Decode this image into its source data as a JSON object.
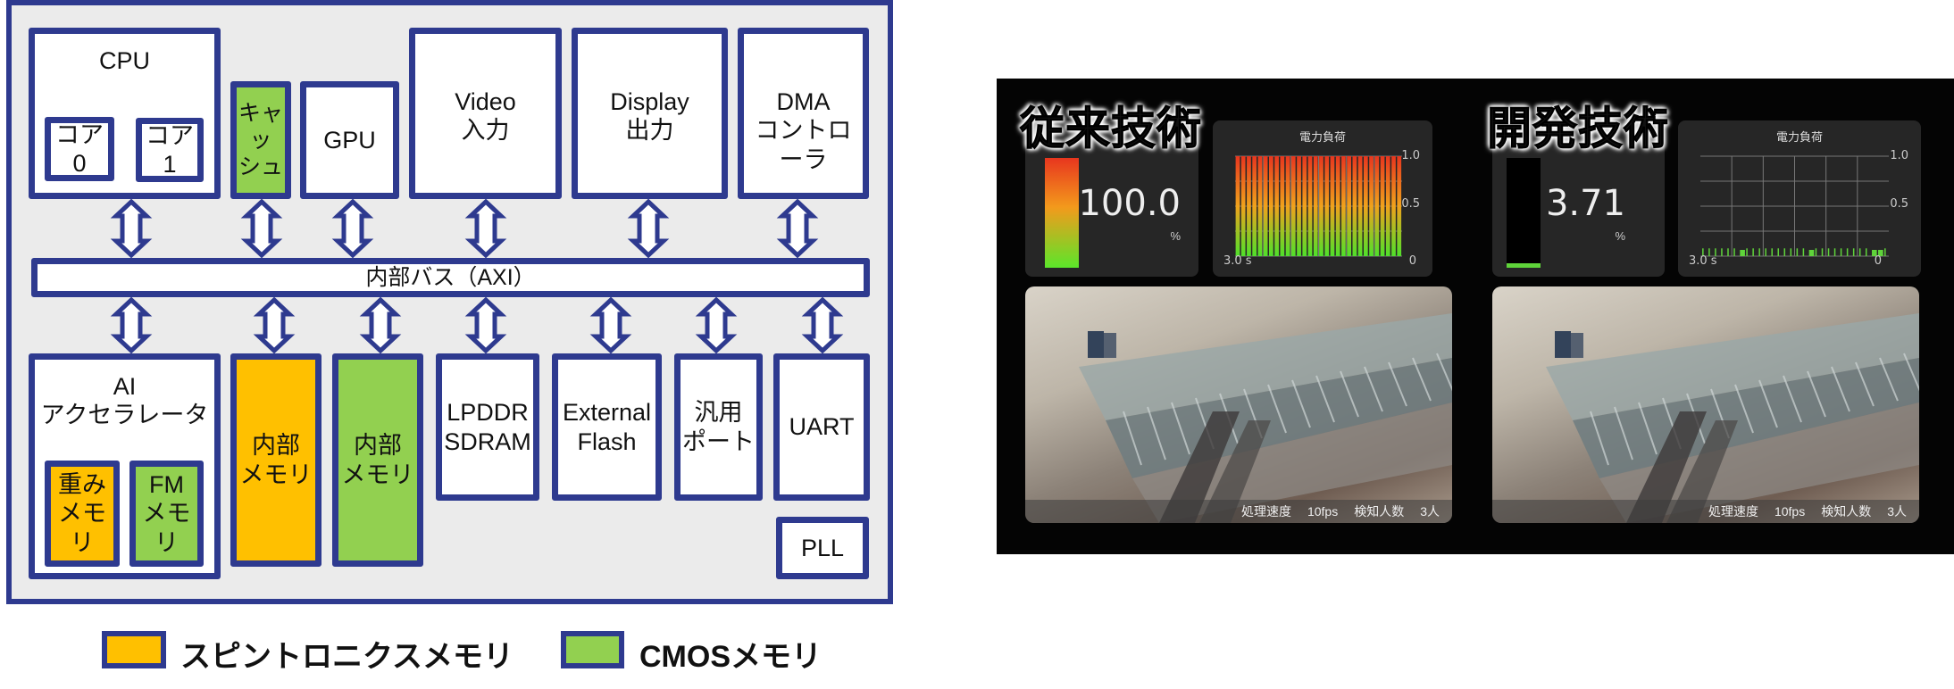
{
  "diagram": {
    "bus_label": "内部バス（AXI）",
    "blocks": {
      "cpu": "CPU",
      "core0": "コア0",
      "core1": "コア1",
      "cache_line1": "キャッ",
      "cache_line2": "シュ",
      "gpu": "GPU",
      "video_line1": "Video",
      "video_line2": "入力",
      "display_line1": "Display",
      "display_line2": "出力",
      "dma_line1": "DMA",
      "dma_line2": "コントローラ",
      "ai_line1": "AI",
      "ai_line2": "アクセラレータ",
      "weight_mem_line1": "重み",
      "weight_mem_line2": "メモリ",
      "fm_mem_line1": "FM",
      "fm_mem_line2": "メモリ",
      "internal_mem_spin_line1": "内部",
      "internal_mem_spin_line2": "メモリ",
      "internal_mem_cmos_line1": "内部",
      "internal_mem_cmos_line2": "メモリ",
      "lpddr_line1": "LPDDR",
      "lpddr_line2": "SDRAM",
      "flash_line1": "External",
      "flash_line2": "Flash",
      "gpio_line1": "汎用",
      "gpio_line2": "ポート",
      "uart": "UART",
      "pll": "PLL"
    },
    "colors": {
      "border": "#2e3a8f",
      "spintronics": "#ffc000",
      "cmos": "#92d050",
      "background": "#ebebeb"
    },
    "legend": [
      {
        "label": "スピントロニクスメモリ",
        "color": "#ffc000"
      },
      {
        "label": "CMOSメモリ",
        "color": "#92d050"
      }
    ]
  },
  "demo": {
    "panels": [
      {
        "heading": "従来技術",
        "gauge_value": "100.0",
        "gauge_unit": "%",
        "gauge_level": 1.0,
        "chart_title": "電力負荷",
        "status_speed_label": "処理速度",
        "status_speed_value": "10fps",
        "status_count_label": "検知人数",
        "status_count_value": "3人"
      },
      {
        "heading": "開発技術",
        "gauge_value": "3.71",
        "gauge_unit": "%",
        "gauge_level": 0.0371,
        "chart_title": "電力負荷",
        "status_speed_label": "処理速度",
        "status_speed_value": "10fps",
        "status_count_label": "検知人数",
        "status_count_value": "3人"
      }
    ]
  },
  "chart_data": [
    {
      "type": "bar",
      "title": "電力負荷",
      "x_ticks": [
        "3.0 s",
        "0"
      ],
      "y_ticks": [
        "1.0",
        "0.5"
      ],
      "ylim": [
        0,
        1.0
      ],
      "xlim_s": [
        3.0,
        0
      ],
      "grid": true,
      "values": [
        1,
        1,
        1,
        1,
        1,
        1,
        1,
        1,
        1,
        1,
        1,
        1,
        1,
        1,
        1,
        1,
        1,
        1,
        1,
        1,
        1,
        1,
        1,
        1,
        1,
        1,
        1,
        1,
        1,
        1
      ]
    },
    {
      "type": "bar",
      "title": "電力負荷",
      "x_ticks": [
        "3.0 s",
        "0"
      ],
      "y_ticks": [
        "1.0",
        "0.5"
      ],
      "ylim": [
        0,
        1.0
      ],
      "xlim_s": [
        3.0,
        0
      ],
      "grid": true,
      "values": [
        0.02,
        0.02,
        0.02,
        0.02,
        0.02,
        0.02,
        0.05,
        0.02,
        0.02,
        0.02,
        0.02,
        0.02,
        0.02,
        0.02,
        0.02,
        0.02,
        0.02,
        0.05,
        0.02,
        0.02,
        0.02,
        0.02,
        0.02,
        0.02,
        0.02,
        0.02,
        0.02,
        0.05,
        0.05,
        0.02
      ]
    }
  ]
}
